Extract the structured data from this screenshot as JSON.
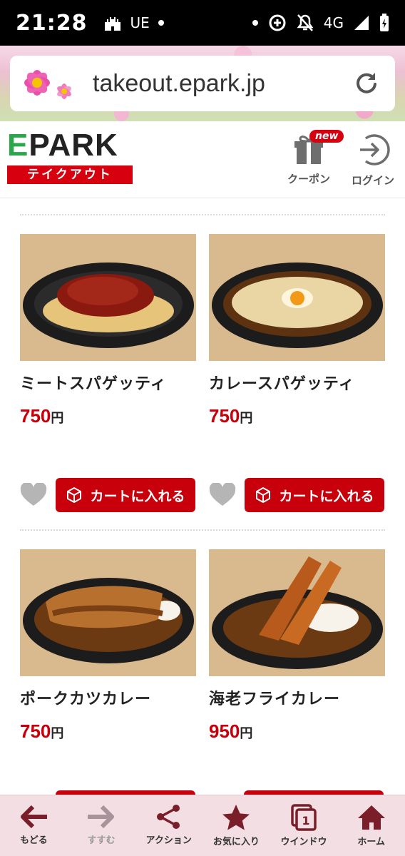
{
  "status_bar": {
    "time": "21:28",
    "carrier_label": "UE",
    "network": "4G"
  },
  "browser": {
    "url": "takeout.epark.jp"
  },
  "header": {
    "logo_text": "EPARK",
    "logo_subtitle": "テイクアウト",
    "coupon_label": "クーポン",
    "coupon_badge": "new",
    "login_label": "ログイン"
  },
  "products": [
    {
      "name": "ミートスパゲッティ",
      "price": "750",
      "currency": "円",
      "photo": "meat-sauce-spaghetti"
    },
    {
      "name": "カレースパゲッティ",
      "price": "750",
      "currency": "円",
      "photo": "curry-spaghetti"
    },
    {
      "name": "ポークカツカレー",
      "price": "750",
      "currency": "円",
      "photo": "pork-katsu-curry"
    },
    {
      "name": "海老フライカレー",
      "price": "950",
      "currency": "円",
      "photo": "fried-shrimp-curry"
    }
  ],
  "cart_button_label": "カートに入れる",
  "bottom_nav": [
    {
      "label": "もどる",
      "icon": "arrow-left-icon"
    },
    {
      "label": "すすむ",
      "icon": "arrow-right-icon"
    },
    {
      "label": "アクション",
      "icon": "share-icon"
    },
    {
      "label": "お気に入り",
      "icon": "star-icon"
    },
    {
      "label": "ウインドウ",
      "icon": "windows-icon",
      "badge": "1"
    },
    {
      "label": "ホーム",
      "icon": "home-icon"
    }
  ],
  "colors": {
    "brand_red": "#c8000c",
    "nav_bg": "#f3dfe3",
    "nav_icon": "#7a1f2a",
    "logo_green": "#2aa74a"
  }
}
